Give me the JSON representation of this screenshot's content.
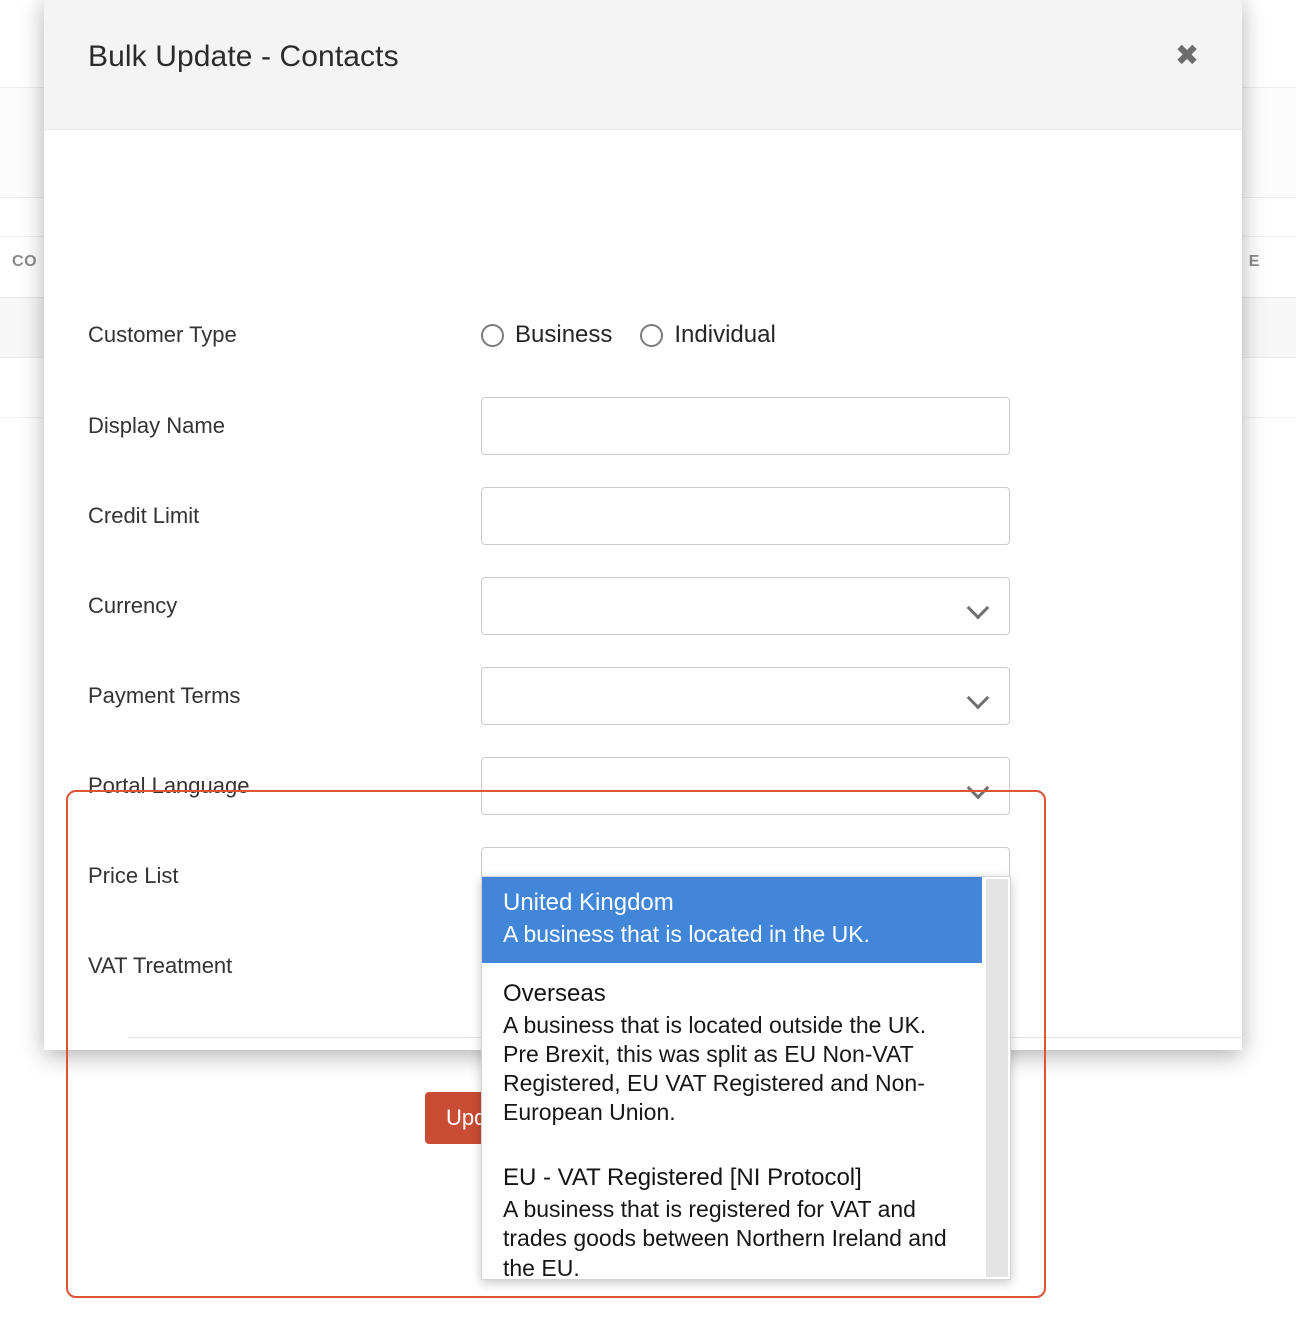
{
  "background": {
    "table_header_left": "CO",
    "table_header_right": "E"
  },
  "modal": {
    "title": "Bulk Update - Contacts",
    "close_icon": "close-icon",
    "close_glyph": "✖",
    "footer": {
      "update_label": "Update"
    }
  },
  "form": {
    "rows": [
      {
        "label": "Customer Type",
        "type": "radio"
      },
      {
        "label": "Display Name",
        "type": "text",
        "value": "",
        "placeholder": ""
      },
      {
        "label": "Credit Limit",
        "type": "text",
        "value": "",
        "placeholder": ""
      },
      {
        "label": "Currency",
        "type": "select",
        "value": ""
      },
      {
        "label": "Payment Terms",
        "type": "select",
        "value": ""
      },
      {
        "label": "Portal Language",
        "type": "select",
        "value": ""
      },
      {
        "label": "Price List",
        "type": "select",
        "value": ""
      },
      {
        "label": "VAT Treatment",
        "type": "select",
        "value": ""
      }
    ],
    "customer_type": {
      "options": [
        {
          "label": "Business",
          "checked": false
        },
        {
          "label": "Individual",
          "checked": false
        }
      ]
    }
  },
  "vat_dropdown": {
    "open": true,
    "options": [
      {
        "title": "United Kingdom",
        "description": "A business that is located in the UK.",
        "selected": true
      },
      {
        "title": "Overseas",
        "description": "A business that is located outside the UK. Pre Brexit, this was split as EU Non-VAT Registered, EU VAT Registered and Non-European Union.",
        "selected": false
      },
      {
        "title": "EU - VAT Registered [NI Protocol]",
        "description": "A business that is registered for VAT and trades goods between Northern Ireland and the EU.",
        "selected": false
      }
    ]
  },
  "colors": {
    "highlight_border": "#dd5533",
    "selected_option_bg": "#4186d8",
    "update_button_bg": "#c94c35",
    "header_bg": "#f4f4f4"
  }
}
